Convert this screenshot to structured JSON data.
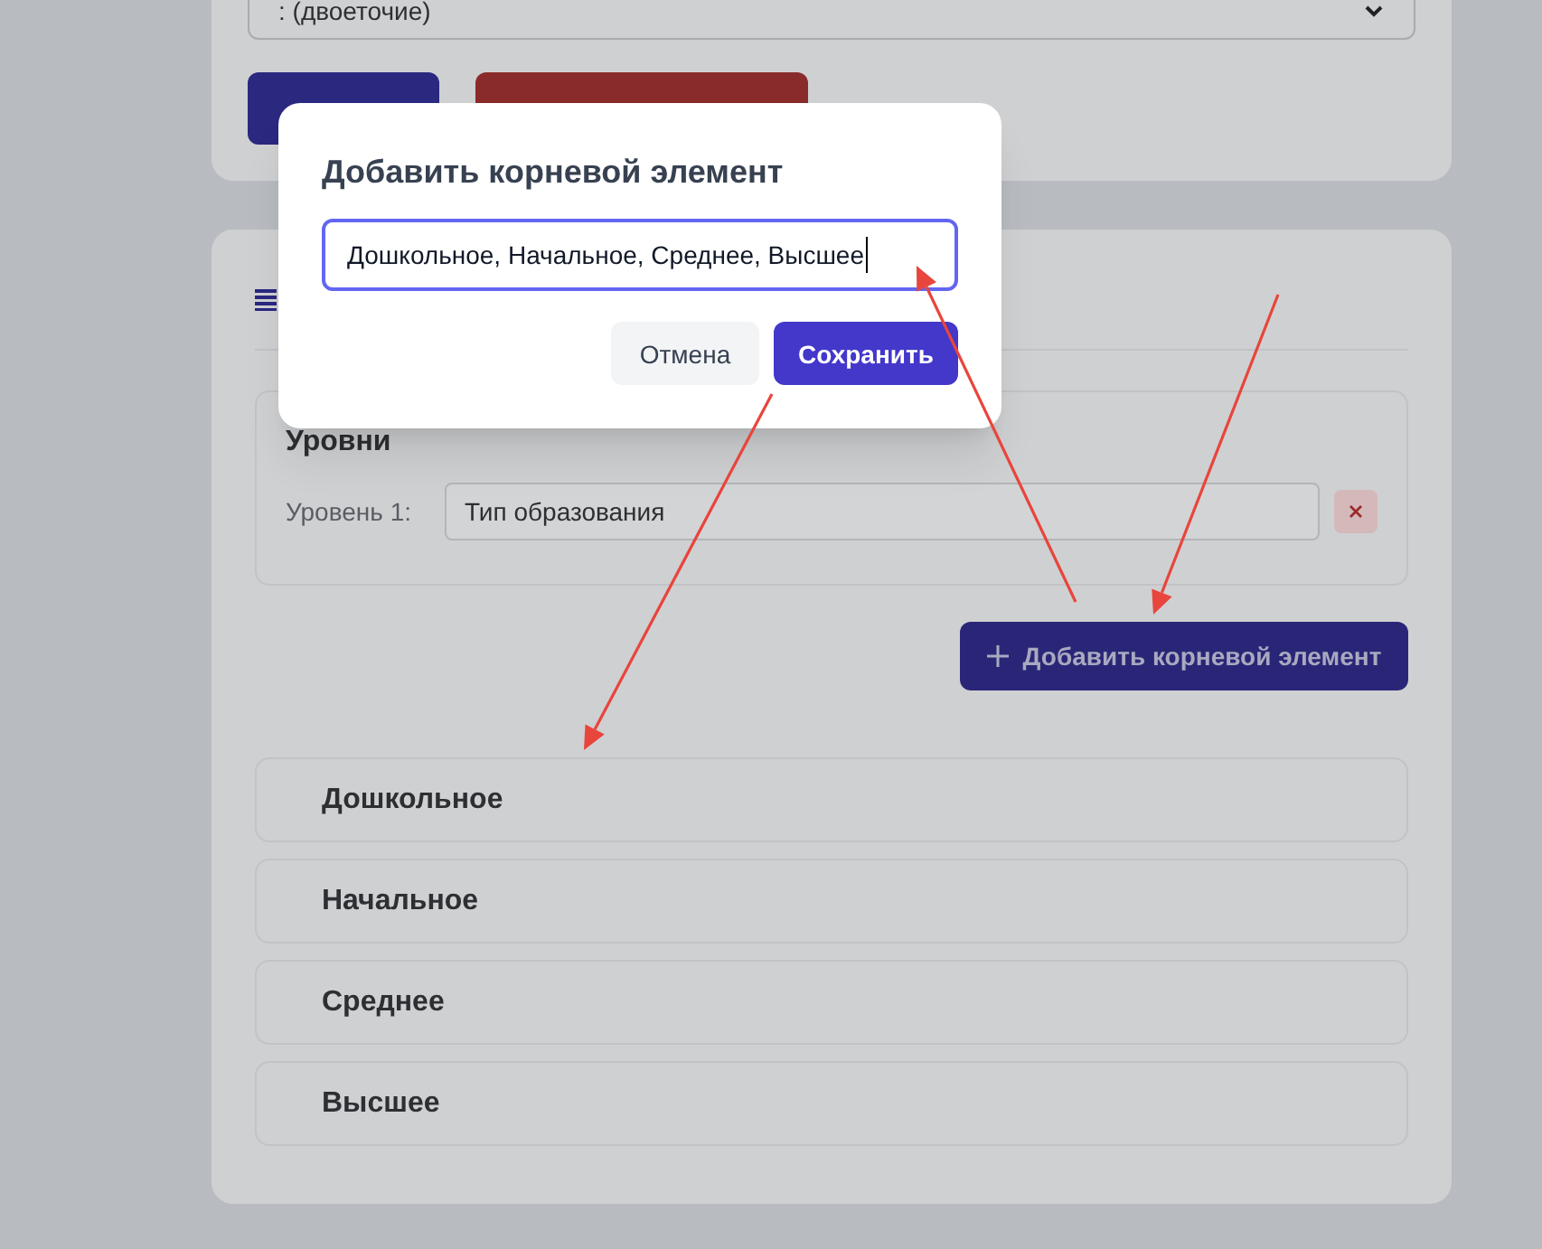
{
  "top_card": {
    "separator_select": {
      "value": ": (двоеточие)"
    },
    "buttons": [
      {
        "kind": "primary"
      },
      {
        "kind": "danger"
      }
    ]
  },
  "structure_card": {
    "levels": {
      "title": "Уровни",
      "items": [
        {
          "label": "Уровень 1:",
          "value": "Тип образования"
        }
      ]
    },
    "add_button": {
      "label": "Добавить корневой элемент"
    },
    "root_items": [
      {
        "label": "Дошкольное"
      },
      {
        "label": "Начальное"
      },
      {
        "label": "Среднее"
      },
      {
        "label": "Высшее"
      }
    ]
  },
  "dialog": {
    "title": "Добавить корневой элемент",
    "input": {
      "value": "Дошкольное, Начальное, Среднее, Высшее"
    },
    "buttons": [
      {
        "label": "Отмена",
        "kind": "secondary"
      },
      {
        "label": "Сохранить",
        "kind": "primary"
      }
    ]
  }
}
